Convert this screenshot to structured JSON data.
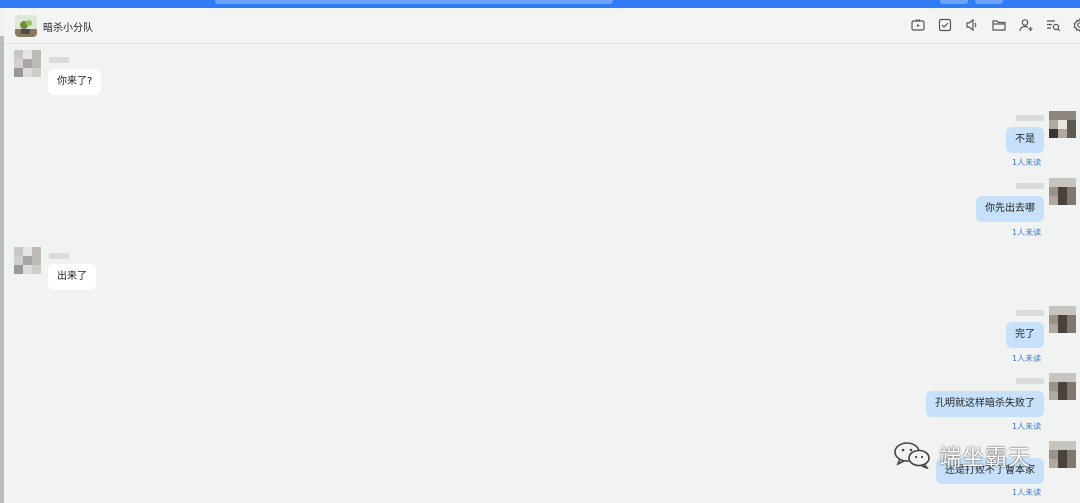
{
  "window": {
    "accent_color": "#2f7cf6"
  },
  "header": {
    "group_name": "暗杀小分队",
    "icons": [
      "video-call-icon",
      "checklist-icon",
      "announcement-icon",
      "folder-icon",
      "add-member-icon",
      "search-history-icon",
      "settings-icon"
    ]
  },
  "messages": [
    {
      "side": "left",
      "text": "你来了?"
    },
    {
      "side": "right",
      "text": "不是",
      "status": "1人未读"
    },
    {
      "side": "right",
      "text": "你先出去哪",
      "status": "1人未读"
    },
    {
      "side": "left",
      "text": "出来了"
    },
    {
      "side": "right",
      "text": "完了",
      "status": "1人未读"
    },
    {
      "side": "right",
      "text": "孔明就这样暗杀失败了",
      "status": "1人未读"
    },
    {
      "side": "right",
      "text": "还是打败不了曹本家",
      "status": "1人未读"
    }
  ],
  "watermark": {
    "text": "端坐霸天"
  },
  "colors": {
    "bubble_out": "#c7e1fa",
    "bubble_in": "#ffffff",
    "unread": "#3a77d8",
    "background": "#f1f3f2"
  }
}
